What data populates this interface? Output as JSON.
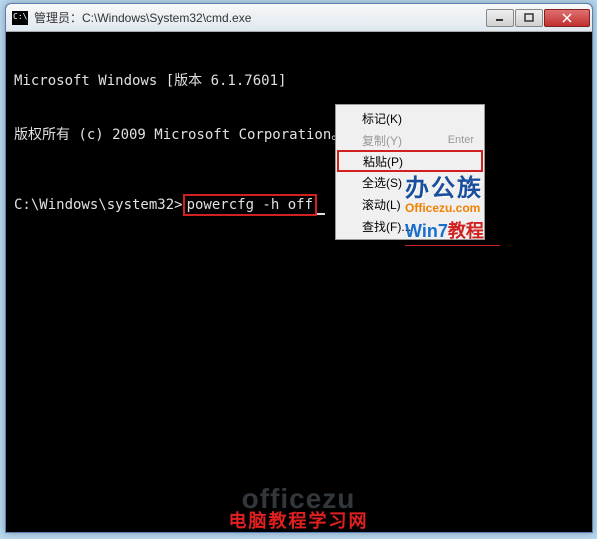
{
  "titlebar": {
    "icon_text": "C:\\",
    "text": "管理员：C:\\Windows\\System32\\cmd.exe"
  },
  "terminal": {
    "line1": "Microsoft Windows [版本 6.1.7601]",
    "line2": "版权所有 (c) 2009 Microsoft Corporation。保留所有权利。",
    "prompt": "C:\\Windows\\system32>",
    "command": "powercfg -h off"
  },
  "menu": {
    "items": [
      {
        "label": "标记(K)",
        "shortcut": "",
        "disabled": false
      },
      {
        "label": "复制(Y)",
        "shortcut": "Enter",
        "disabled": true
      },
      {
        "label": "粘贴(P)",
        "shortcut": "",
        "disabled": false,
        "highlighted": true
      },
      {
        "label": "全选(S)",
        "shortcut": "",
        "disabled": false
      },
      {
        "label": "滚动(L)",
        "shortcut": "",
        "disabled": false
      },
      {
        "label": "查找(F)...",
        "shortcut": "",
        "disabled": false
      }
    ]
  },
  "watermark1": {
    "brand": "办公族",
    "url": "Officezu.com",
    "sub_a": "Win7",
    "sub_b": "教程"
  },
  "watermark2": {
    "ghost": "officezu",
    "text": "电脑教程学习网"
  }
}
